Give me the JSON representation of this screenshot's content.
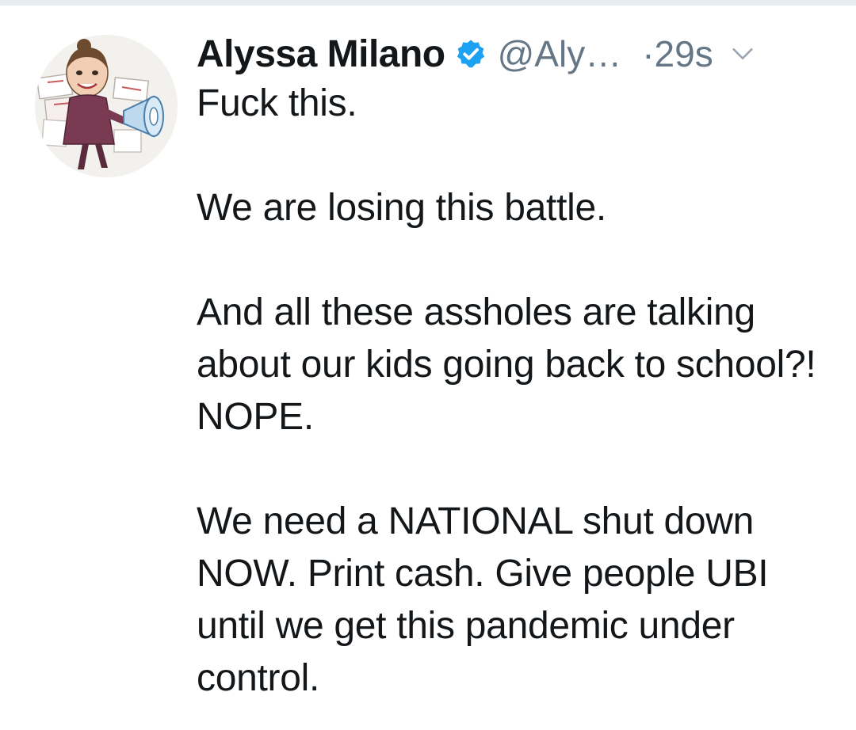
{
  "tweet": {
    "author": {
      "display_name": "Alyssa Milano",
      "verified": true,
      "handle": "@Aly…",
      "avatar_icon": "caricature-avatar-with-megaphone"
    },
    "timestamp": "·29s",
    "menu_icon": "chevron-down-icon",
    "paragraphs": [
      "Fuck this.",
      "We are losing this battle.",
      "And all these assholes are talking about our kids going back to school?! NOPE.",
      "We need a NATIONAL shut down NOW. Print cash. Give people UBI until we get this pandemic under control."
    ]
  },
  "colors": {
    "text": "#14171a",
    "secondary": "#657786",
    "verified_blue": "#1da1f2",
    "divider": "#e6ecf0"
  }
}
